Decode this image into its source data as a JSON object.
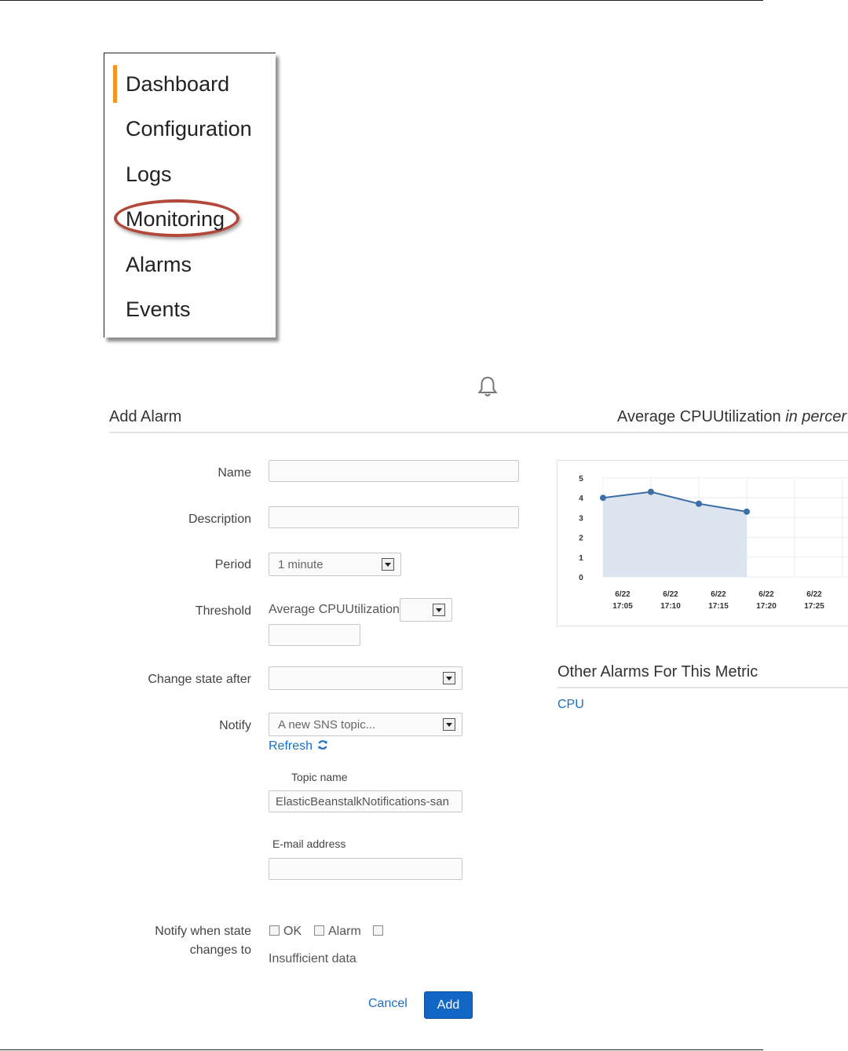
{
  "nav": {
    "items": [
      {
        "label": "Dashboard",
        "active": true
      },
      {
        "label": "Configuration"
      },
      {
        "label": "Logs"
      },
      {
        "label": "Monitoring",
        "highlighted": true
      },
      {
        "label": "Alarms"
      },
      {
        "label": "Events"
      }
    ],
    "active_color": "#f7931e",
    "highlight_color": "#b3473a"
  },
  "form": {
    "title": "Add Alarm",
    "name_label": "Name",
    "name_value": "",
    "description_label": "Description",
    "description_value": "",
    "period_label": "Period",
    "period_value": "1 minute",
    "threshold_label": "Threshold",
    "threshold_metric": "Average CPUUtilization",
    "threshold_operator": "",
    "threshold_value": "",
    "change_state_label": "Change state after",
    "change_state_value": "",
    "notify_label": "Notify",
    "notify_value": "A new SNS topic...",
    "refresh_label": "Refresh",
    "topic_name_label": "Topic name",
    "topic_name_value": "ElasticBeanstalkNotifications-san",
    "email_label": "E-mail address",
    "email_value": "",
    "notify_when_label_1": "Notify when state",
    "notify_when_label_2": "changes to",
    "checkbox_ok": "OK",
    "checkbox_alarm": "Alarm",
    "checkbox_insufficient": "Insufficient data",
    "cancel_label": "Cancel",
    "add_label": "Add",
    "accent": "#1267c4"
  },
  "chart_header": {
    "title_main": "Average CPUUtilization",
    "title_italic": "in percer"
  },
  "chart_data": {
    "type": "area",
    "title": "Average CPUUtilization in percent",
    "x": [
      "6/22 17:05",
      "6/22 17:10",
      "6/22 17:15",
      "6/22 17:20"
    ],
    "x_ticks": [
      [
        "6/22",
        "17:05"
      ],
      [
        "6/22",
        "17:10"
      ],
      [
        "6/22",
        "17:15"
      ],
      [
        "6/22",
        "17:20"
      ],
      [
        "6/22",
        "17:25"
      ]
    ],
    "values": [
      4.0,
      4.3,
      3.7,
      3.3
    ],
    "y_ticks": [
      0,
      1,
      2,
      3,
      4,
      5
    ],
    "ylim": [
      0,
      5
    ],
    "grid": true,
    "line_color": "#3a6ea5",
    "fill_color": "#dce5ef"
  },
  "other_alarms": {
    "title": "Other Alarms For This Metric",
    "items": [
      "CPU"
    ]
  }
}
